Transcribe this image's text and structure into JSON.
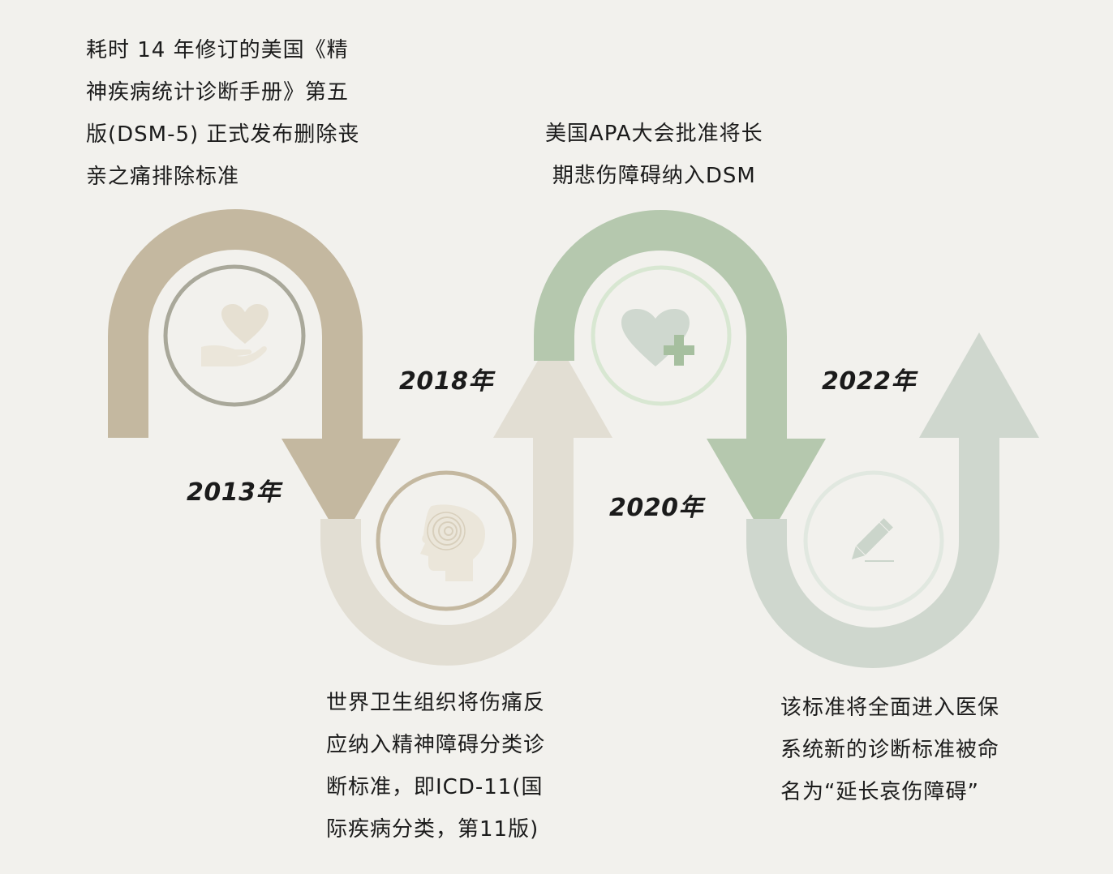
{
  "milestones": [
    {
      "year": "2013年",
      "lines": [
        "耗时 14 年修订的美国《精",
        "神疾病统计诊断手册》第五",
        "版(DSM-5) 正式发布删除丧",
        "亲之痛排除标准"
      ],
      "icon": "heart-in-hand-icon",
      "color": "#c4b8a0"
    },
    {
      "year": "2018年",
      "lines": [
        "世界卫生组织将伤痛反",
        "应纳入精神障碍分类诊",
        "断标准，即ICD-11(国",
        "际疾病分类，第11版)"
      ],
      "icon": "head-spiral-icon",
      "color": "#e2ded3"
    },
    {
      "year": "2020年",
      "lines": [
        "美国APA大会批准将长",
        "期悲伤障碍纳入DSM"
      ],
      "icon": "heart-plus-icon",
      "color": "#b5c8ae"
    },
    {
      "year": "2022年",
      "lines": [
        "该标准将全面进入医保",
        "系统新的诊断标准被命",
        "名为“延长哀伤障碍”"
      ],
      "icon": "pencil-icon",
      "color": "#cfd7ce"
    }
  ]
}
